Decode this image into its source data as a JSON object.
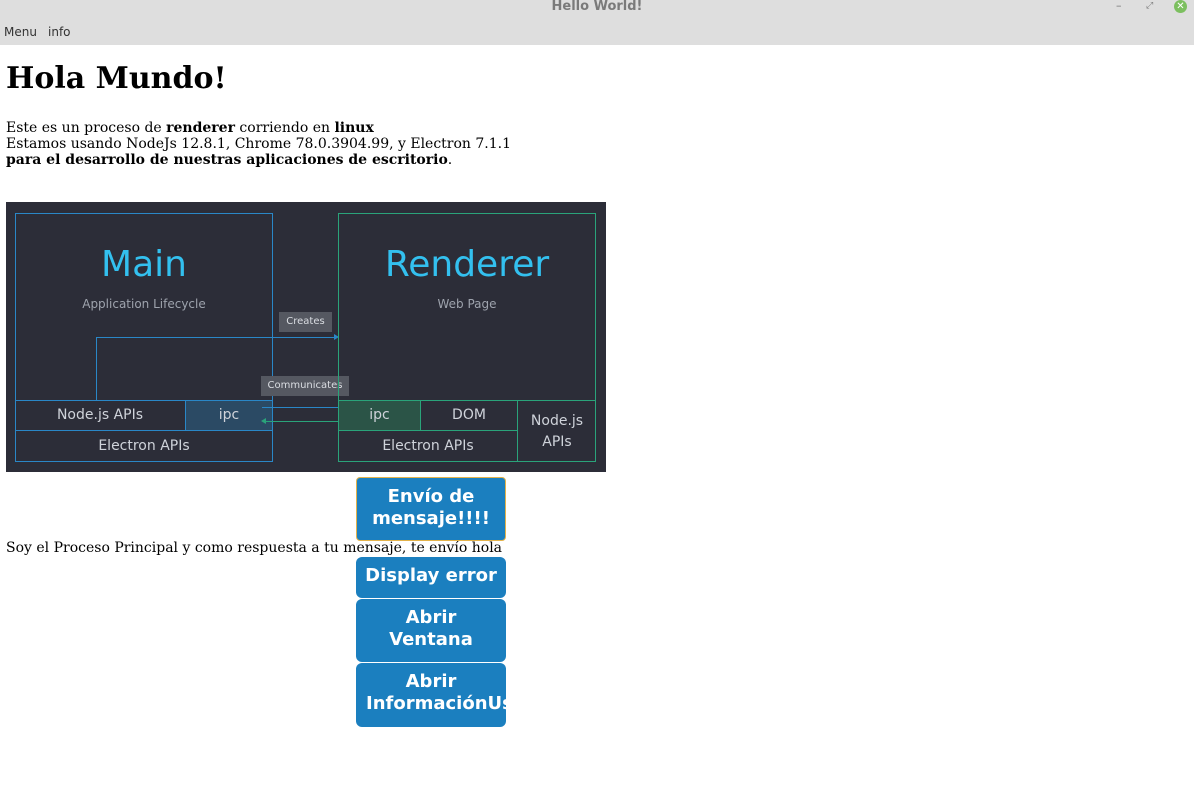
{
  "window": {
    "title": "Hello World!",
    "controls": {
      "minimize": "–",
      "maximize": "⤢",
      "close": "✕"
    }
  },
  "menu": {
    "items": [
      "Menu",
      "info"
    ]
  },
  "main": {
    "heading": "Hola Mundo!",
    "line1": {
      "prefix": "Este es un proceso de ",
      "process": "renderer",
      "middle": " corriendo en ",
      "platform": "linux"
    },
    "line2": "Estamos usando NodeJs 12.8.1, Chrome 78.0.3904.99, y Electron 7.1.1",
    "line3": {
      "bold": "para el desarrollo de nuestras aplicaciones de escritorio",
      "suffix": "."
    }
  },
  "diagram": {
    "main_title": "Main",
    "main_subtitle": "Application Lifecycle",
    "renderer_title": "Renderer",
    "renderer_subtitle": "Web Page",
    "creates": "Creates",
    "communicates": "Communicates",
    "main_nodejs": "Node.js APIs",
    "main_ipc": "ipc",
    "main_electron": "Electron APIs",
    "renderer_ipc": "ipc",
    "renderer_dom": "DOM",
    "renderer_nodejs_1": "Node.js",
    "renderer_nodejs_2": "APIs",
    "renderer_electron": "Electron APIs",
    "colors": {
      "background": "#2c2d38",
      "main_border": "#2a87c7",
      "renderer_border": "#2aa37a",
      "title": "#33c0ef"
    }
  },
  "buttons": {
    "send_message_1": "Envío de",
    "send_message_2": "mensaje!!!!",
    "display_error": "Display error",
    "open_window_1": "Abrir",
    "open_window_2": "Ventana",
    "open_info_1": "Abrir",
    "open_info_2": "InformaciónUs"
  },
  "response": "Soy el Proceso Principal y como respuesta a tu mensaje, te envío hola",
  "colors": {
    "button": "#1b7fbf",
    "chrome": "#dedede",
    "focus_border": "#e3b24a"
  }
}
